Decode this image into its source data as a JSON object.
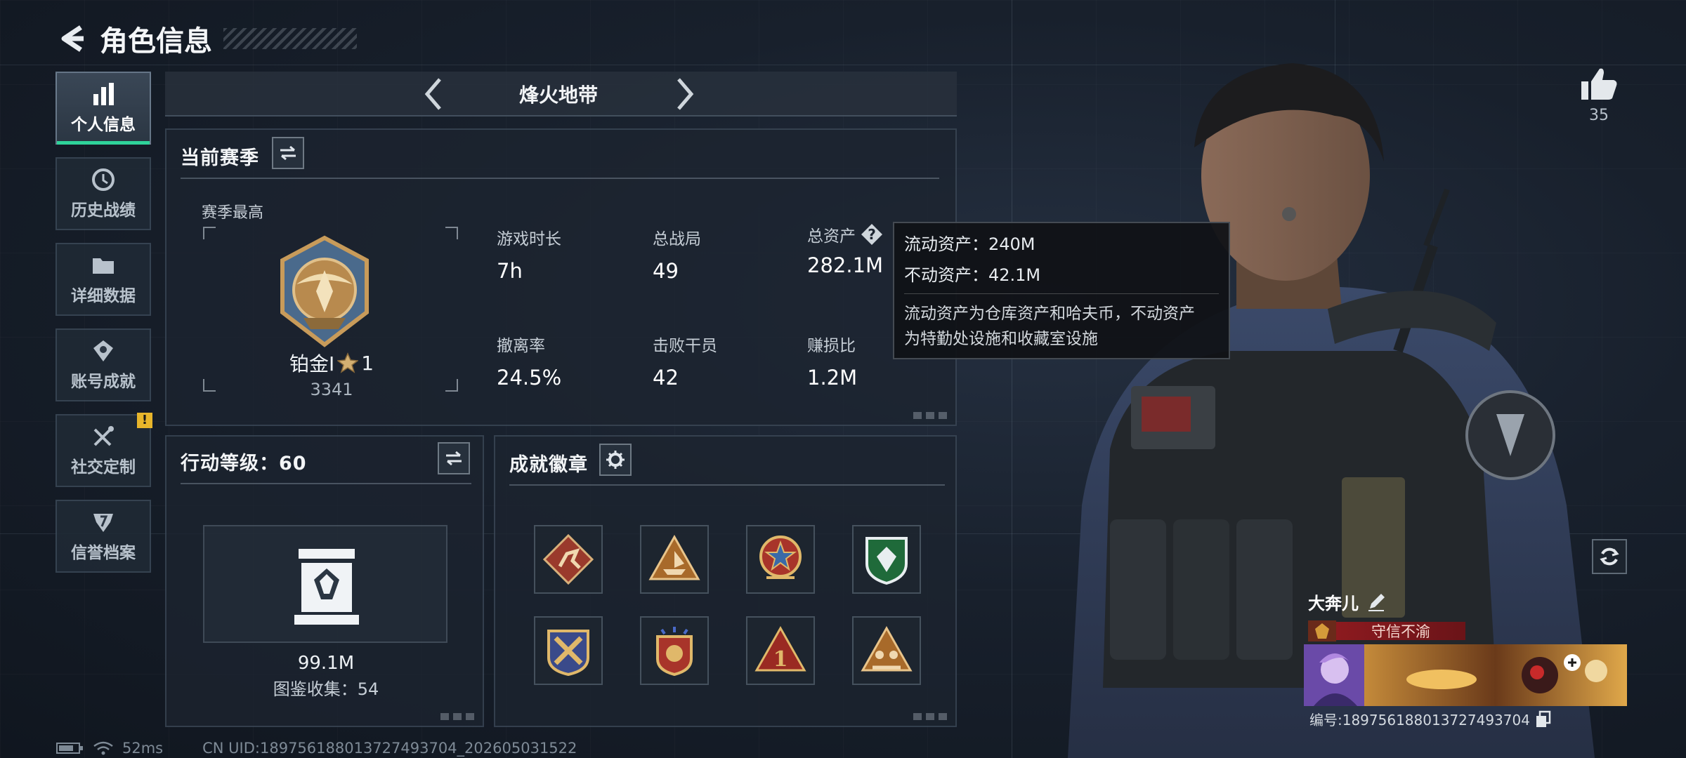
{
  "header": {
    "title": "角色信息"
  },
  "nav": {
    "items": [
      {
        "label": "个人信息",
        "active": true
      },
      {
        "label": "历史战绩"
      },
      {
        "label": "详细数据"
      },
      {
        "label": "账号成就"
      },
      {
        "label": "社交定制",
        "alert": "!"
      },
      {
        "label": "信誉档案"
      }
    ]
  },
  "mode_selector": {
    "current": "烽火地带"
  },
  "season": {
    "title": "当前赛季",
    "best_label": "赛季最高",
    "rank_name": "铂金Ⅰ",
    "rank_stars": "1",
    "rank_points": "3341",
    "stats": [
      {
        "label": "游戏时长",
        "value": "7h"
      },
      {
        "label": "总战局",
        "value": "49"
      },
      {
        "label": "总资产",
        "value": "282.1M"
      },
      {
        "label": "撤离率",
        "value": "24.5%"
      },
      {
        "label": "击败干员",
        "value": "42"
      },
      {
        "label": "赚损比",
        "value": "1.2M"
      }
    ]
  },
  "tooltip": {
    "liquid": "流动资产：240M",
    "fixed": "不动资产：42.1M",
    "desc_line1": "流动资产为仓库资产和哈夫币，不动资产",
    "desc_line2": "为特勤处设施和收藏室设施"
  },
  "action_level": {
    "title": "行动等级：60",
    "collection_value": "99.1M",
    "collection_label": "图鉴收集：54"
  },
  "achievements": {
    "title": "成就徽章",
    "badges": [
      "badge-1",
      "badge-2",
      "badge-3",
      "badge-4",
      "badge-5",
      "badge-6",
      "badge-7",
      "badge-8"
    ]
  },
  "profile": {
    "likes": "35",
    "player_name": "大奔儿",
    "player_title": "守信不渝",
    "player_id": "编号:1897561880137274937​04"
  },
  "status_bar": {
    "ping": "52ms",
    "uid": "CN UID:189756188013727493704_202605031522"
  },
  "colors": {
    "accent_green": "#2fd39a",
    "alert_yellow": "#e7b52b",
    "title_red": "#8c1a1f"
  }
}
